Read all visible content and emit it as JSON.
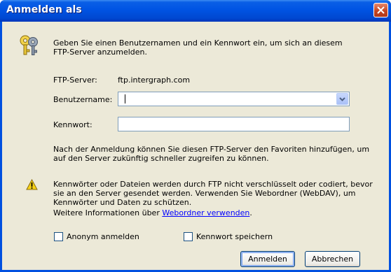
{
  "window": {
    "title": "Anmelden als"
  },
  "intro": {
    "line1": "Geben Sie einen Benutzernamen und ein Kennwort ein, um sich an diesem",
    "line2": "FTP-Server anzumelden."
  },
  "ftp_server": {
    "label": "FTP-Server:",
    "value": "ftp.intergraph.com"
  },
  "username": {
    "label": "Benutzername:",
    "value": ""
  },
  "password": {
    "label": "Kennwort:",
    "value": ""
  },
  "favorites_note": {
    "line1": "Nach der Anmeldung können Sie diesen FTP-Server den Favoriten hinzufügen, um",
    "line2": "auf den Server zukünftig schneller zugreifen zu können."
  },
  "warning": {
    "line1": "Kennwörter oder Dateien werden durch FTP nicht verschlüsselt oder codiert, bevor",
    "line2": "sie an den Server gesendet werden. Verwenden Sie Webordner (WebDAV), um",
    "line3": "Kennwörter und Daten zu schützen.",
    "more_prefix": "Weitere Informationen über ",
    "more_link": "Webordner verwenden",
    "more_suffix": "."
  },
  "checkboxes": {
    "anonymous": {
      "label": "Anonym anmelden",
      "checked": false
    },
    "save_password": {
      "label": "Kennwort speichern",
      "checked": false
    }
  },
  "buttons": {
    "ok": "Anmelden",
    "cancel": "Abbrechen"
  },
  "icons": {
    "title_close": "close-icon",
    "dialog": "keys-icon",
    "warning": "warning-icon"
  },
  "colors": {
    "titlebar": "#0054e3",
    "dialog_bg": "#ece9d8",
    "link": "#0000ff",
    "close": "#c64520"
  }
}
